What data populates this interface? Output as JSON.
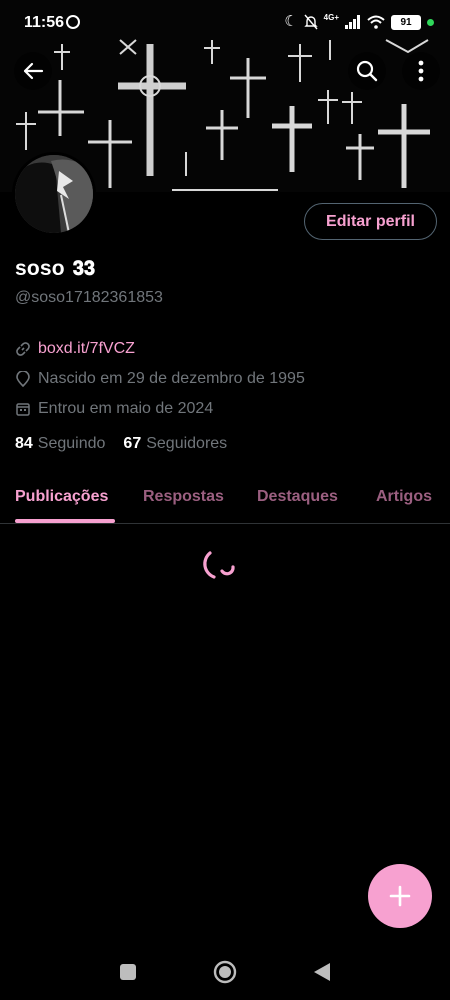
{
  "status_bar": {
    "time": "11:56",
    "network": "4G+",
    "battery": "91",
    "icons": [
      "whatsapp-icon",
      "moon-icon",
      "mute-icon",
      "signal-icon",
      "wifi-icon",
      "battery-icon"
    ]
  },
  "header": {
    "back_icon": "arrow-left-icon",
    "search_icon": "search-icon",
    "more_icon": "more-vertical-icon"
  },
  "profile": {
    "edit_button": "Editar perfil",
    "display_name": "soso",
    "name_emoji": "𝟑𝟑",
    "handle": "@soso17182361853",
    "link": "boxd.it/7fVCZ",
    "birth": "Nascido em 29 de dezembro de 1995",
    "joined": "Entrou em maio de 2024",
    "following_count": "84",
    "following_label": "Seguindo",
    "followers_count": "67",
    "followers_label": "Seguidores"
  },
  "tabs": [
    {
      "label": "Publicações",
      "active": true
    },
    {
      "label": "Respostas",
      "active": false
    },
    {
      "label": "Destaques",
      "active": false
    },
    {
      "label": "Artigos",
      "active": false
    }
  ],
  "colors": {
    "accent": "#f7a1d0",
    "background": "#000000",
    "secondary_text": "#71767b"
  }
}
